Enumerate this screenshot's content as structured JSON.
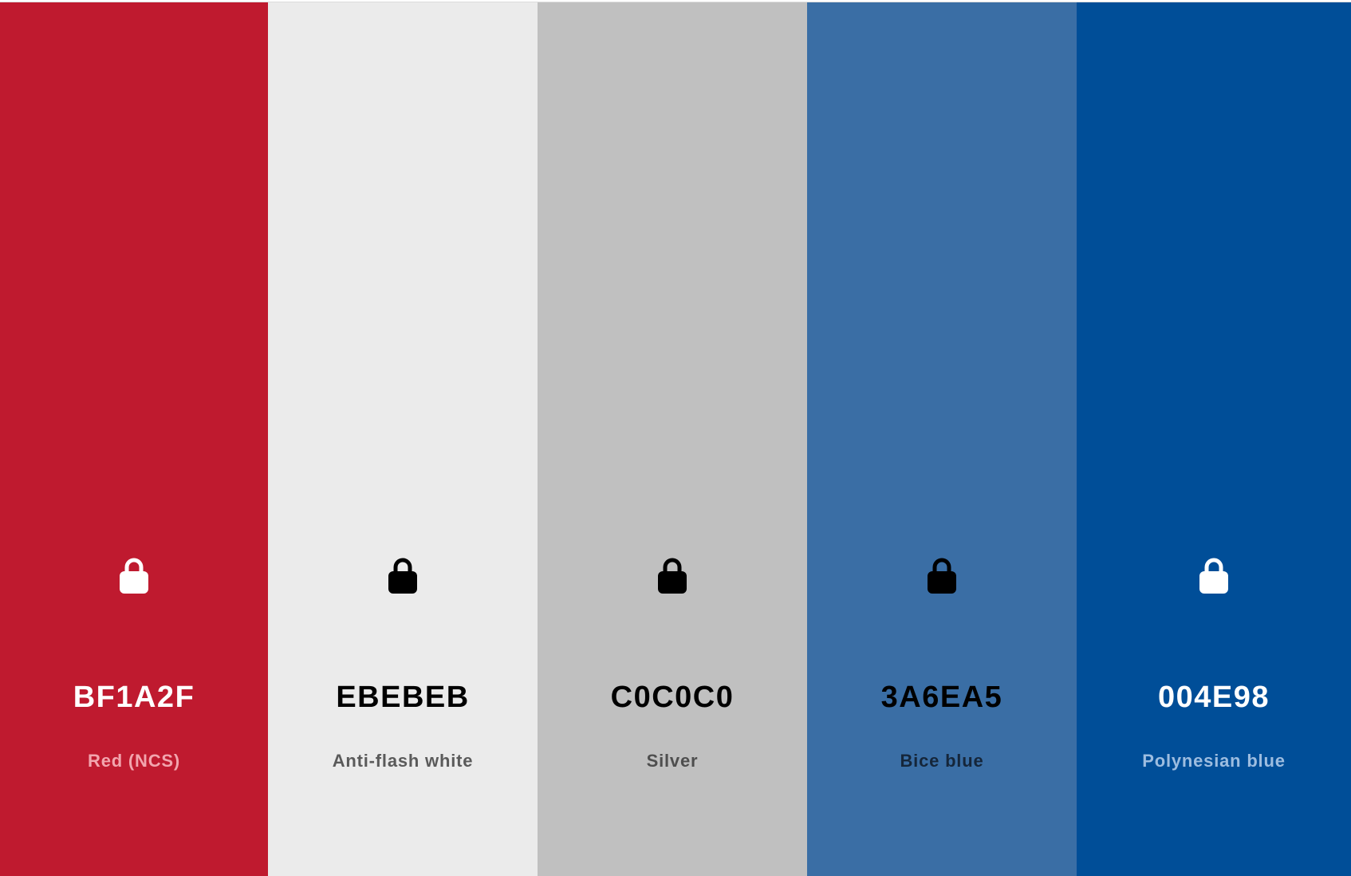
{
  "palette": {
    "colors": [
      {
        "hex": "BF1A2F",
        "name": "Red (NCS)",
        "background": "#BF1A2F",
        "hex_text_color": "#FFFFFF",
        "name_text_color": "#F2A5AE",
        "lock_color": "#FFFFFF",
        "lock_icon": "lock-icon"
      },
      {
        "hex": "EBEBEB",
        "name": "Anti-flash white",
        "background": "#EBEBEB",
        "hex_text_color": "#000000",
        "name_text_color": "#5A5A5A",
        "lock_color": "#000000",
        "lock_icon": "lock-icon"
      },
      {
        "hex": "C0C0C0",
        "name": "Silver",
        "background": "#C0C0C0",
        "hex_text_color": "#000000",
        "name_text_color": "#4E4E4E",
        "lock_color": "#000000",
        "lock_icon": "lock-icon"
      },
      {
        "hex": "3A6EA5",
        "name": "Bice blue",
        "background": "#3A6EA5",
        "hex_text_color": "#000000",
        "name_text_color": "#15263A",
        "lock_color": "#000000",
        "lock_icon": "lock-icon"
      },
      {
        "hex": "004E98",
        "name": "Polynesian blue",
        "background": "#004E98",
        "hex_text_color": "#FFFFFF",
        "name_text_color": "#9DBDE0",
        "lock_color": "#FFFFFF",
        "lock_icon": "lock-icon"
      }
    ]
  }
}
